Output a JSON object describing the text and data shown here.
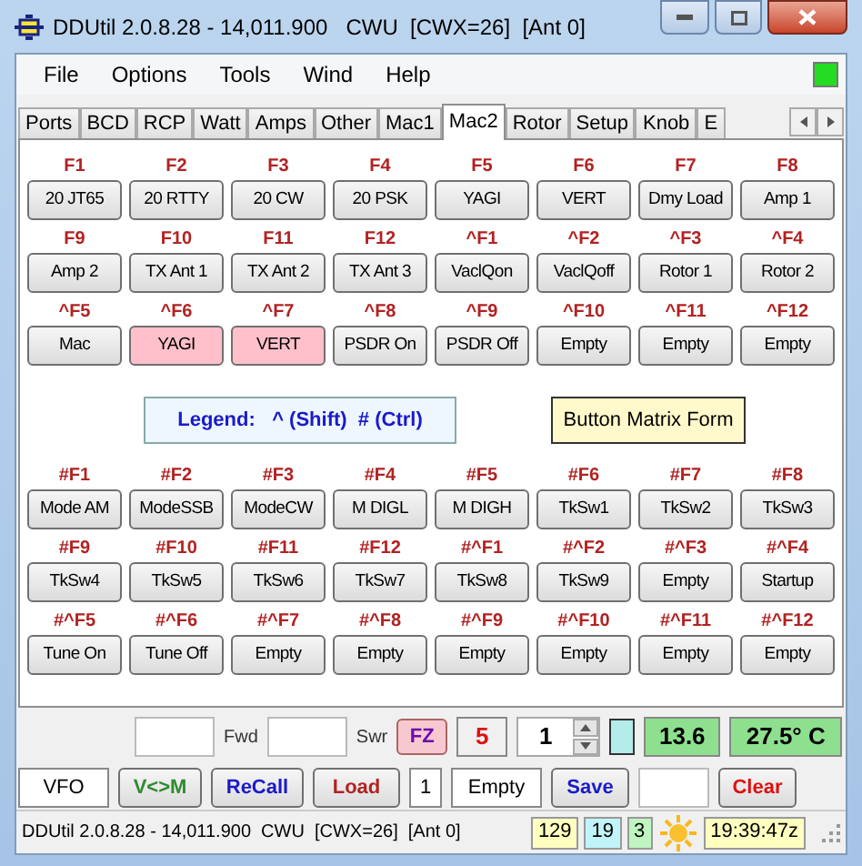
{
  "window": {
    "title": "DDUtil 2.0.8.28 - 14,011.900   CWU  [CWX=26]  [Ant 0]"
  },
  "menu": {
    "items": [
      "File",
      "Options",
      "Tools",
      "Wind",
      "Help"
    ],
    "indicator": {
      "on": true
    }
  },
  "tabs": [
    {
      "label": "Ports",
      "selected": false
    },
    {
      "label": "BCD",
      "selected": false
    },
    {
      "label": "RCP",
      "selected": false
    },
    {
      "label": "Watt",
      "selected": false
    },
    {
      "label": "Amps",
      "selected": false
    },
    {
      "label": "Other",
      "selected": false
    },
    {
      "label": "Mac1",
      "selected": false
    },
    {
      "label": "Mac2",
      "selected": true
    },
    {
      "label": "Rotor",
      "selected": false
    },
    {
      "label": "Setup",
      "selected": false
    },
    {
      "label": "Knob",
      "selected": false
    },
    {
      "label": "E",
      "selected": false
    }
  ],
  "upper_matrix": [
    {
      "key": "F1",
      "label": "20 JT65",
      "highlighted": false
    },
    {
      "key": "F2",
      "label": "20 RTTY",
      "highlighted": false
    },
    {
      "key": "F3",
      "label": "20 CW",
      "highlighted": false
    },
    {
      "key": "F4",
      "label": "20 PSK",
      "highlighted": false
    },
    {
      "key": "F5",
      "label": "YAGI",
      "highlighted": false
    },
    {
      "key": "F6",
      "label": "VERT",
      "highlighted": false
    },
    {
      "key": "F7",
      "label": "Dmy Load",
      "highlighted": false
    },
    {
      "key": "F8",
      "label": "Amp 1",
      "highlighted": false
    },
    {
      "key": "F9",
      "label": "Amp 2",
      "highlighted": false
    },
    {
      "key": "F10",
      "label": "TX Ant 1",
      "highlighted": false
    },
    {
      "key": "F11",
      "label": "TX Ant 2",
      "highlighted": false
    },
    {
      "key": "F12",
      "label": "TX Ant 3",
      "highlighted": false
    },
    {
      "key": "^F1",
      "label": "VaclQon",
      "highlighted": false
    },
    {
      "key": "^F2",
      "label": "VaclQoff",
      "highlighted": false
    },
    {
      "key": "^F3",
      "label": "Rotor 1",
      "highlighted": false
    },
    {
      "key": "^F4",
      "label": "Rotor 2",
      "highlighted": false
    },
    {
      "key": "^F5",
      "label": "Mac",
      "highlighted": false
    },
    {
      "key": "^F6",
      "label": "YAGI",
      "highlighted": true
    },
    {
      "key": "^F7",
      "label": "VERT",
      "highlighted": true
    },
    {
      "key": "^F8",
      "label": "PSDR On",
      "highlighted": false
    },
    {
      "key": "^F9",
      "label": "PSDR Off",
      "highlighted": false
    },
    {
      "key": "^F10",
      "label": "Empty",
      "highlighted": false
    },
    {
      "key": "^F11",
      "label": "Empty",
      "highlighted": false
    },
    {
      "key": "^F12",
      "label": "Empty",
      "highlighted": false
    }
  ],
  "legend": "Legend:   ^ (Shift)  # (Ctrl)",
  "matrix_form_button": "Button Matrix Form",
  "lower_matrix": [
    {
      "key": "#F1",
      "label": "Mode AM",
      "highlighted": false
    },
    {
      "key": "#F2",
      "label": "ModeSSB",
      "highlighted": false
    },
    {
      "key": "#F3",
      "label": "ModeCW",
      "highlighted": false
    },
    {
      "key": "#F4",
      "label": "M DIGL",
      "highlighted": false
    },
    {
      "key": "#F5",
      "label": "M DIGH",
      "highlighted": false
    },
    {
      "key": "#F6",
      "label": "TkSw1",
      "highlighted": false
    },
    {
      "key": "#F7",
      "label": "TkSw2",
      "highlighted": false
    },
    {
      "key": "#F8",
      "label": "TkSw3",
      "highlighted": false
    },
    {
      "key": "#F9",
      "label": "TkSw4",
      "highlighted": false
    },
    {
      "key": "#F10",
      "label": "TkSw5",
      "highlighted": false
    },
    {
      "key": "#F11",
      "label": "TkSw6",
      "highlighted": false
    },
    {
      "key": "#F12",
      "label": "TkSw7",
      "highlighted": false
    },
    {
      "key": "#^F1",
      "label": "TkSw8",
      "highlighted": false
    },
    {
      "key": "#^F2",
      "label": "TkSw9",
      "highlighted": false
    },
    {
      "key": "#^F3",
      "label": "Empty",
      "highlighted": false
    },
    {
      "key": "#^F4",
      "label": "Startup",
      "highlighted": false
    },
    {
      "key": "#^F5",
      "label": "Tune On",
      "highlighted": false
    },
    {
      "key": "#^F6",
      "label": "Tune Off",
      "highlighted": false
    },
    {
      "key": "#^F7",
      "label": "Empty",
      "highlighted": false
    },
    {
      "key": "#^F8",
      "label": "Empty",
      "highlighted": false
    },
    {
      "key": "#^F9",
      "label": "Empty",
      "highlighted": false
    },
    {
      "key": "#^F10",
      "label": "Empty",
      "highlighted": false
    },
    {
      "key": "#^F11",
      "label": "Empty",
      "highlighted": false
    },
    {
      "key": "#^F12",
      "label": "Empty",
      "highlighted": false
    }
  ],
  "meter_row": [
    {
      "kind": "field"
    },
    {
      "kind": "label",
      "text": "Fwd"
    },
    {
      "kind": "field"
    },
    {
      "kind": "label",
      "text": "Swr"
    },
    {
      "kind": "button",
      "text": "FZ",
      "color": "#6a0dad"
    },
    {
      "kind": "display",
      "text": "5",
      "color": "#f0f0f0"
    },
    {
      "kind": "spinner",
      "text": "1"
    },
    {
      "kind": "swatch",
      "color": "#b4ecec"
    },
    {
      "kind": "display",
      "text": "13.6",
      "color": "#8ee08e"
    },
    {
      "kind": "display",
      "text": "27.5° C",
      "color": "#8ee08e"
    }
  ],
  "memory_row": [
    {
      "kind": "display",
      "text": "VFO",
      "color": "#ffffff"
    },
    {
      "kind": "button",
      "text": "V<>M",
      "color": "#2e8b2e"
    },
    {
      "kind": "button",
      "text": "ReCall",
      "color": "#1a1acc"
    },
    {
      "kind": "button",
      "text": "Load",
      "color": "#b22222"
    },
    {
      "kind": "display",
      "text": "1",
      "color": "#ffffff"
    },
    {
      "kind": "display",
      "text": "Empty",
      "color": "#ffffff"
    },
    {
      "kind": "button",
      "text": "Save",
      "color": "#1a1acc"
    },
    {
      "kind": "field"
    },
    {
      "kind": "button",
      "text": "Clear",
      "color": "#dd1111"
    }
  ],
  "status_bar": {
    "text": "DDUtil 2.0.8.28 - 14,011.900  CWU  [CWX=26]  [Ant 0]",
    "chips": [
      {
        "text": "129",
        "color": "#ffffc0"
      },
      {
        "text": "19",
        "color": "#c0f4f8"
      },
      {
        "text": "3",
        "color": "#c0f4c0"
      }
    ],
    "time": "19:39:47z"
  }
}
